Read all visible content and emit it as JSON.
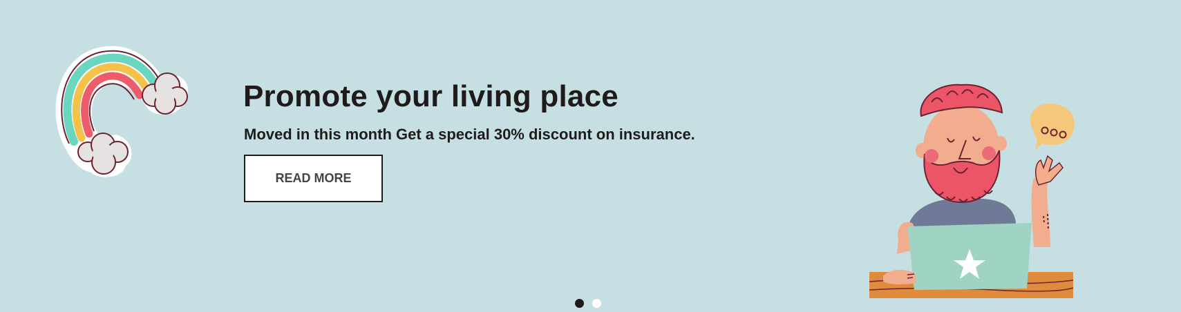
{
  "banner": {
    "headline": "Promote your living place",
    "subtext": "Moved in this month Get a special 30% discount on insurance.",
    "button_label": "READ MORE",
    "background_color": "#c5dfe3"
  },
  "decorations": {
    "left_icon": "rainbow-with-clouds",
    "right_illustration": "bearded-man-with-laptop-and-speech-bubble"
  },
  "carousel": {
    "slides": [
      {
        "label": "slide-1",
        "active": true
      },
      {
        "label": "slide-2",
        "active": false
      }
    ]
  }
}
